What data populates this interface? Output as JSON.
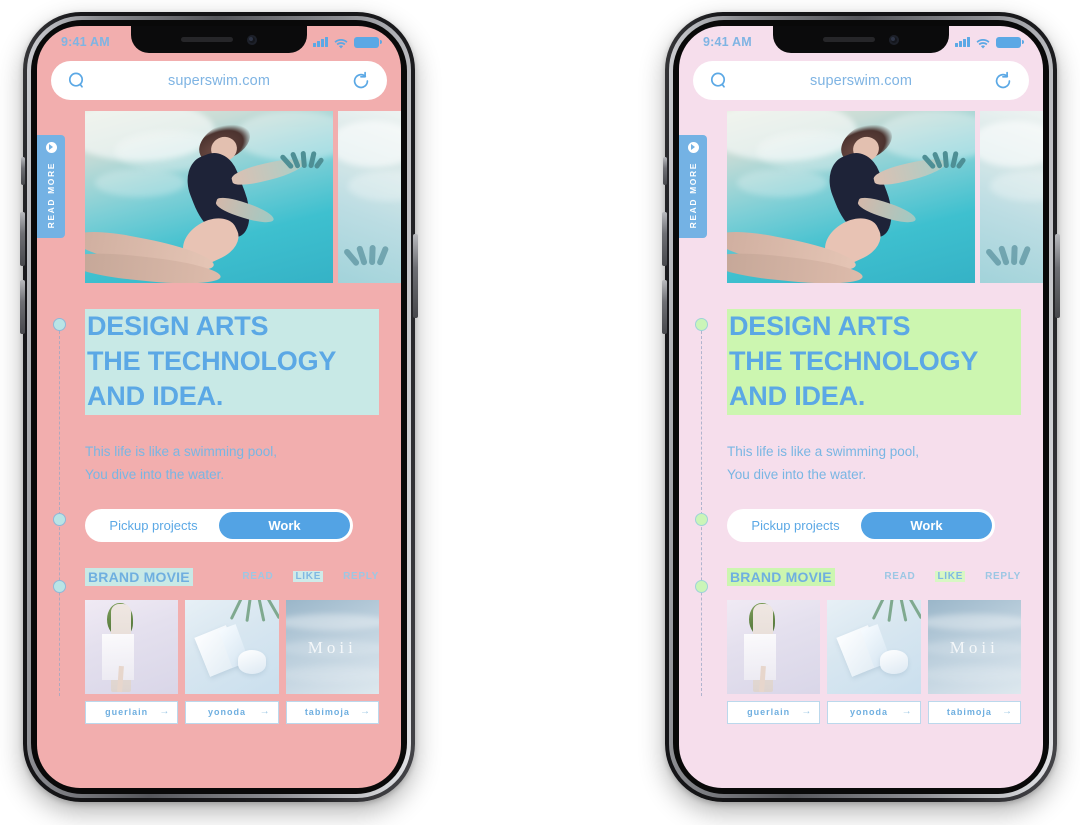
{
  "phones": [
    {
      "id": "phone-left",
      "variant": "a",
      "theme": {
        "page_bg": "#F2AEAE",
        "highlight": "#C8E9E6",
        "accent": "#5BA8E5",
        "marker": "#B9E4E6"
      },
      "status_bar": {
        "time": "9:41 AM"
      },
      "browser": {
        "url": "superswim.com",
        "search_icon": "search-icon",
        "reload_icon": "reload-icon"
      },
      "side_tab": {
        "label": "READ MORE",
        "icon": "play-circle-icon"
      },
      "headline": [
        "DESIGN ARTS",
        "THE TECHNOLOGY",
        "AND IDEA."
      ],
      "subtext": [
        "This life is like a swimming pool,",
        "You dive into the water."
      ],
      "toggle": {
        "left_label": "Pickup projects",
        "right_label": "Work",
        "active": "Work"
      },
      "movie": {
        "title": "BRAND MOVIE",
        "links": [
          {
            "label": "READ",
            "highlighted": false
          },
          {
            "label": "LIKE",
            "highlighted": true
          },
          {
            "label": "REPLY",
            "highlighted": false
          }
        ]
      },
      "thumbnails": [
        {
          "brand": "guerlain",
          "arrow": "→",
          "caption": ""
        },
        {
          "brand": "yonoda",
          "arrow": "→",
          "caption": ""
        },
        {
          "brand": "tabimoja",
          "arrow": "→",
          "caption": "Moii"
        }
      ]
    },
    {
      "id": "phone-right",
      "variant": "b",
      "theme": {
        "page_bg": "#F6DEEC",
        "highlight": "#CCF6B0",
        "accent": "#5BA8E5",
        "marker": "#CBF5B8"
      },
      "status_bar": {
        "time": "9:41 AM"
      },
      "browser": {
        "url": "superswim.com",
        "search_icon": "search-icon",
        "reload_icon": "reload-icon"
      },
      "side_tab": {
        "label": "READ MORE",
        "icon": "play-circle-icon"
      },
      "headline": [
        "DESIGN ARTS",
        "THE TECHNOLOGY",
        "AND IDEA."
      ],
      "subtext": [
        "This life is like a swimming pool,",
        "You dive into the water."
      ],
      "toggle": {
        "left_label": "Pickup projects",
        "right_label": "Work",
        "active": "Work"
      },
      "movie": {
        "title": "BRAND MOVIE",
        "links": [
          {
            "label": "READ",
            "highlighted": false
          },
          {
            "label": "LIKE",
            "highlighted": true
          },
          {
            "label": "REPLY",
            "highlighted": false
          }
        ]
      },
      "thumbnails": [
        {
          "brand": "guerlain",
          "arrow": "→",
          "caption": ""
        },
        {
          "brand": "yonoda",
          "arrow": "→",
          "caption": ""
        },
        {
          "brand": "tabimoja",
          "arrow": "→",
          "caption": "Moii"
        }
      ]
    }
  ]
}
